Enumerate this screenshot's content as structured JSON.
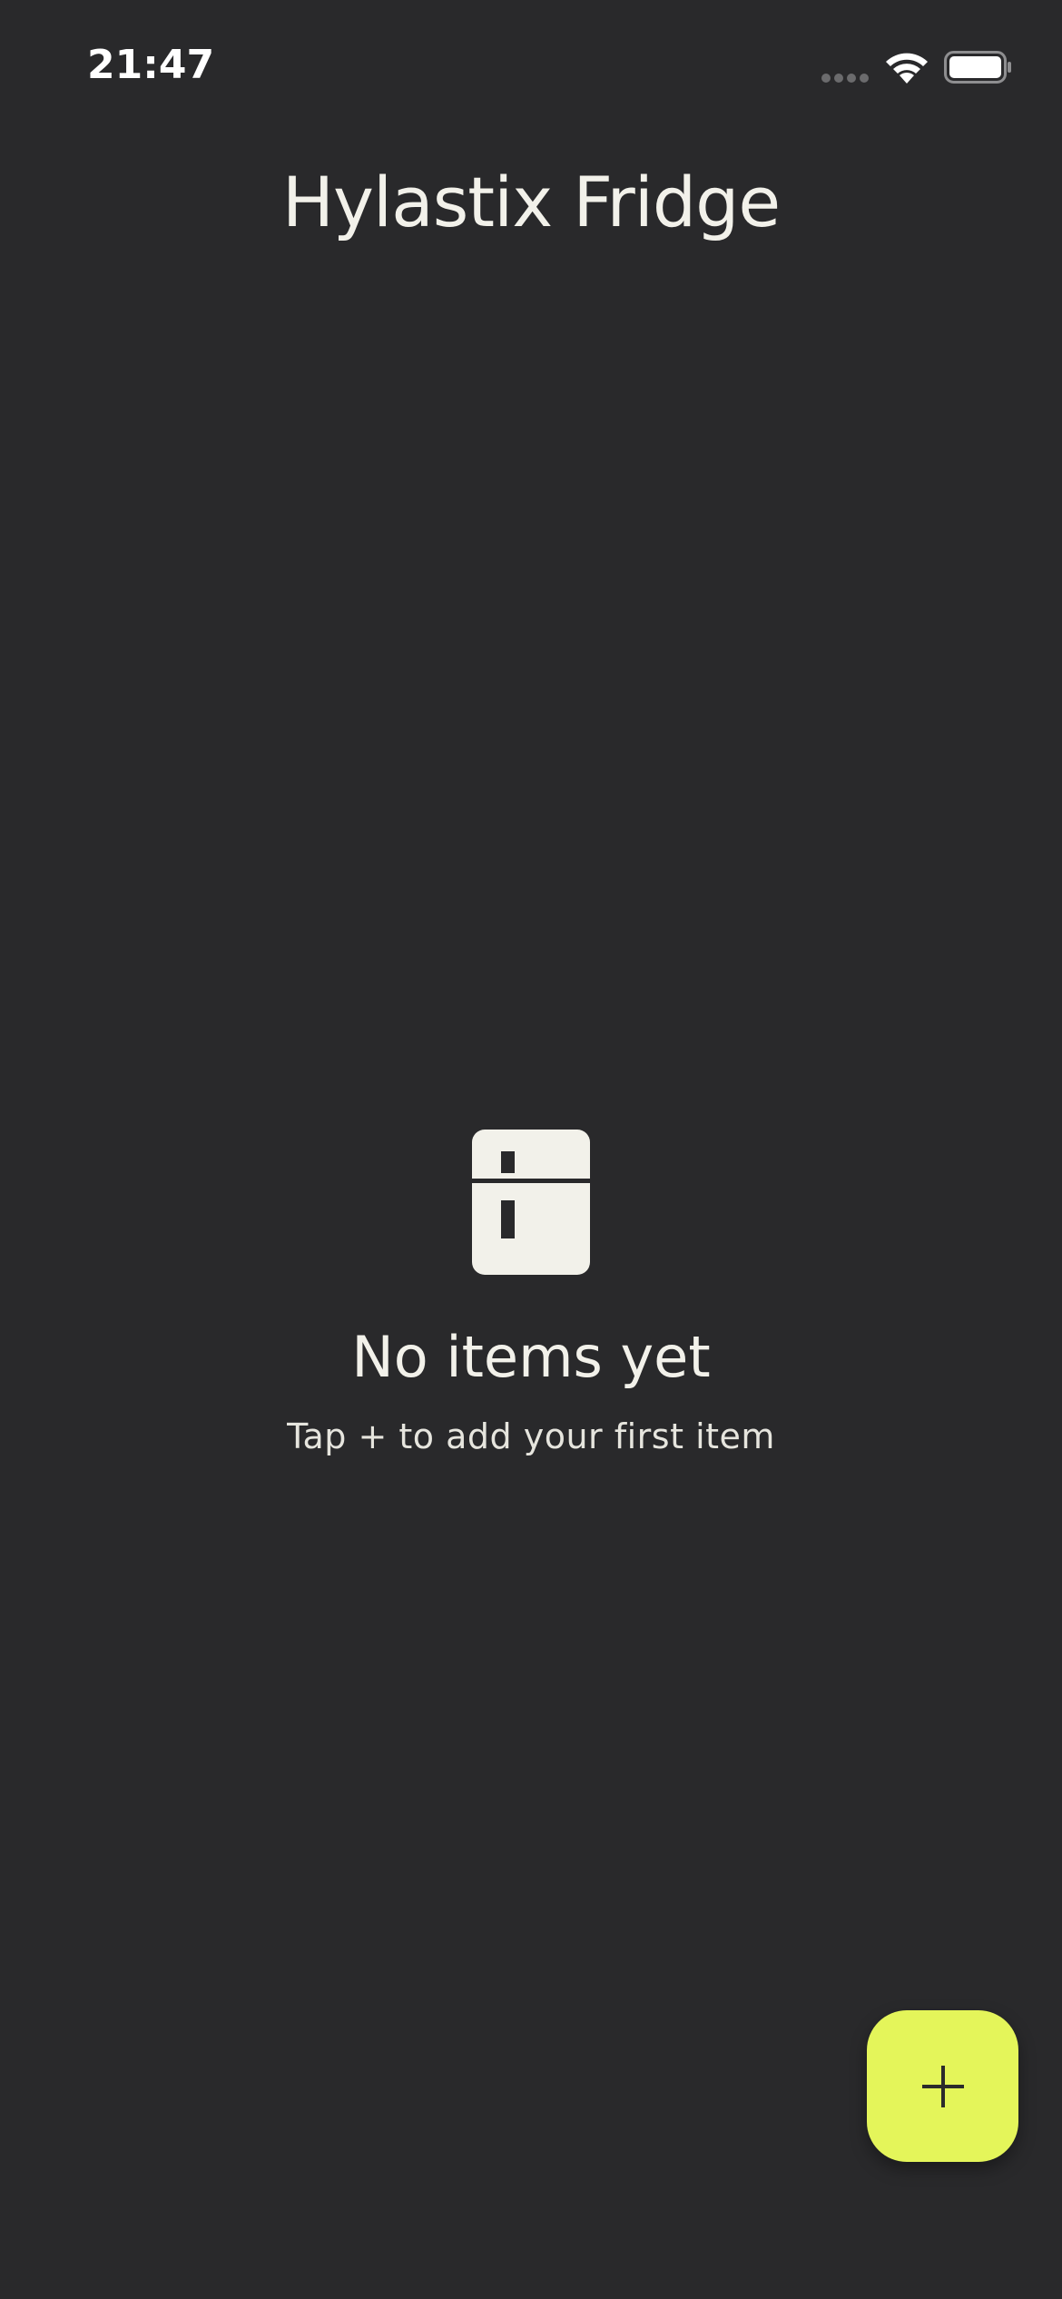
{
  "status_bar": {
    "time": "21:47",
    "icons": [
      "signal-icon",
      "wifi-icon",
      "battery-icon"
    ]
  },
  "header": {
    "title": "Hylastix Fridge"
  },
  "empty_state": {
    "icon": "fridge-icon",
    "title": "No items yet",
    "subtitle": "Tap + to add your first item"
  },
  "fab": {
    "icon": "plus-icon",
    "color": "#e4f55a"
  },
  "colors": {
    "background": "#29292b",
    "text_primary": "#f2f1ea",
    "accent": "#e4f55a"
  }
}
